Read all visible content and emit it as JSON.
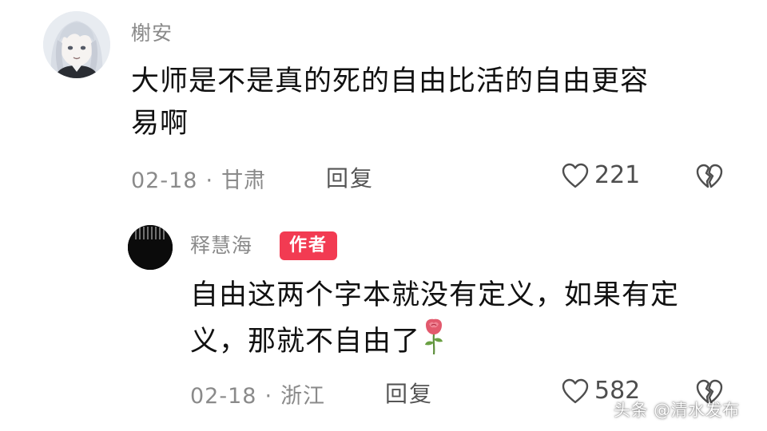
{
  "main_comment": {
    "username": "榭安",
    "text_line1": "大师是不是真的死的自由比活的自由更容",
    "text_line2": "易啊",
    "date": "02-18",
    "location": "甘肃",
    "reply_label": "回复",
    "like_count": "221",
    "icons": {
      "like": "heart-outline-icon",
      "dislike": "broken-heart-icon"
    }
  },
  "reply_comment": {
    "username": "释慧海",
    "badge": "作者",
    "text_line1": "自由这两个字本就没有定义，如果有定",
    "text_line2": "义，那就不自由了",
    "emoji": "rose-icon",
    "date": "02-18",
    "location": "浙江",
    "reply_label": "回复",
    "like_count": "582",
    "icons": {
      "like": "heart-outline-icon",
      "dislike": "broken-heart-icon"
    }
  },
  "watermark": "头条 @清水发布",
  "colors": {
    "badge": "#f23b52",
    "meta_text": "#8a8a8a",
    "body_text": "#111111",
    "background": "#ffffff"
  }
}
